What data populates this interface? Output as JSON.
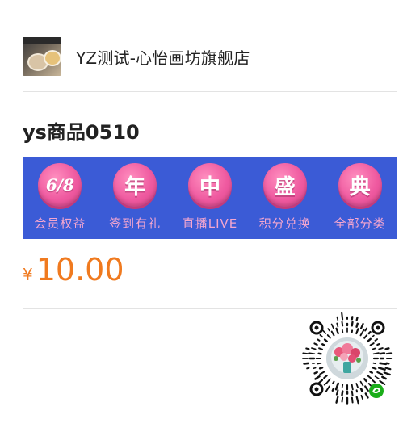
{
  "shop": {
    "name": "YZ测试-心怡画坊旗舰店",
    "avatar": "shop-avatar-image"
  },
  "product": {
    "title": "ys商品0510"
  },
  "banner": {
    "background": "#3b5bd6",
    "items": [
      {
        "badge": "6/8",
        "label": "会员权益"
      },
      {
        "badge": "年",
        "label": "签到有礼"
      },
      {
        "badge": "中",
        "label": "直播LIVE"
      },
      {
        "badge": "盛",
        "label": "积分兑换"
      },
      {
        "badge": "典",
        "label": "全部分类"
      }
    ]
  },
  "price": {
    "currency": "¥",
    "amount": "10.00",
    "color": "#f07a1f"
  },
  "qr": {
    "icon": "mini-program-code",
    "accent": "#1aad19"
  }
}
